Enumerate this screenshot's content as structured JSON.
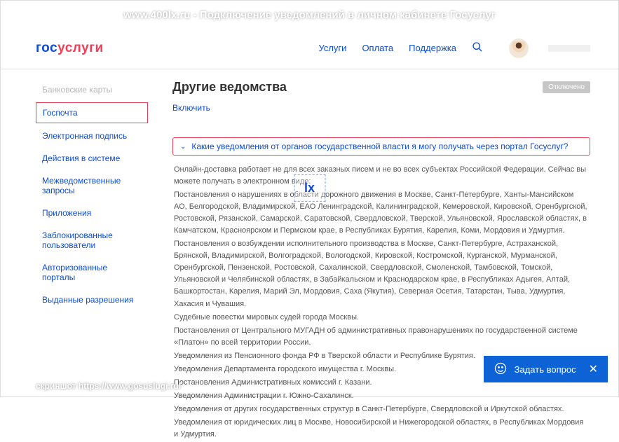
{
  "watermark_top": "www.400lx.ru - Подключение уведомлений в личном кабинете Госуслуг",
  "watermark_bottom": "скриншот https://www.gosuslugi.ru/",
  "watermark_center": "lx",
  "logo": {
    "part1": "гос",
    "part2": "услуги"
  },
  "nav": {
    "services": "Услуги",
    "payment": "Оплата",
    "support": "Поддержка"
  },
  "sidebar": {
    "item0": "Банковские карты",
    "item1": "Госпочта",
    "item2": "Электронная подпись",
    "item3": "Действия в системе",
    "item4": "Межведомственные запросы",
    "item5": "Приложения",
    "item6": "Заблокированные пользователи",
    "item7": "Авторизованные порталы",
    "item8": "Выданные разрешения"
  },
  "main": {
    "title": "Другие ведомства",
    "status": "Отключено",
    "enable": "Включить",
    "accordion_q": "Какие уведомления от органов государственной власти я могу получать через портал Госуслуг?"
  },
  "content": {
    "p1": "Онлайн-доставка работает не для всех заказных писем и не во всех субъектах Российской Федерации. Сейчас вы можете получать в электронном виде:",
    "p2": "Постановления о нарушениях в области дорожного движения в Москве, Санкт-Петербурге, Ханты-Мансийском АО, Белгородской, Владимирской, ЕАО Ленинградской, Калининградской, Кемеровской, Кировской, Оренбургской, Ростовской, Рязанской, Самарской, Саратовской, Свердловской, Тверской, Ульяновской, Ярославской областях, в Камчатском, Красноярском и Пермском крае, в Республиках Бурятия, Карелия, Коми, Мордовия и Удмуртия.",
    "p3": "Постановления о возбуждении исполнительного производства в Москве, Санкт-Петербурге, Астраханской, Брянской, Владимирской, Волгоградской, Вологодской, Кировской, Костромской, Курганской, Мурманской, Оренбургской, Пензенской, Ростовской, Сахалинской, Свердловской, Смоленской, Тамбовской, Томской, Ульяновской и Челябинской областях, в Забайкальском и Краснодарском крае, в Республиках Адыгея, Алтай, Башкортостан, Карелия, Марий Эл, Мордовия, Саха (Якутия), Северная Осетия, Татарстан, Тыва, Удмуртия, Хакасия и Чувашия.",
    "p4": "Судебные повестки мировых судей города Москвы.",
    "p5": "Постановления от Центрального МУГАДН об административных правонарушениях по государственной системе «Платон» по всей территории России.",
    "p6": "Уведомления из Пенсионного фонда РФ в Тверской области и Республике Бурятия.",
    "p7": "Уведомления Департамента городского имущества г. Москвы.",
    "p8": "Постановления Административных комиссий г. Казани.",
    "p9": "Уведомления Администрации г. Южно-Сахалинск.",
    "p10": "Уведомления от других государственных структур в Санкт-Петербурге, Свердловской и Иркутской областях.",
    "p11": "Уведомления от юридических лиц в Москве, Новосибирской и Нижегородской областях, в Республиках Мордовия и Удмуртия."
  },
  "chat": {
    "label": "Задать вопрос"
  }
}
